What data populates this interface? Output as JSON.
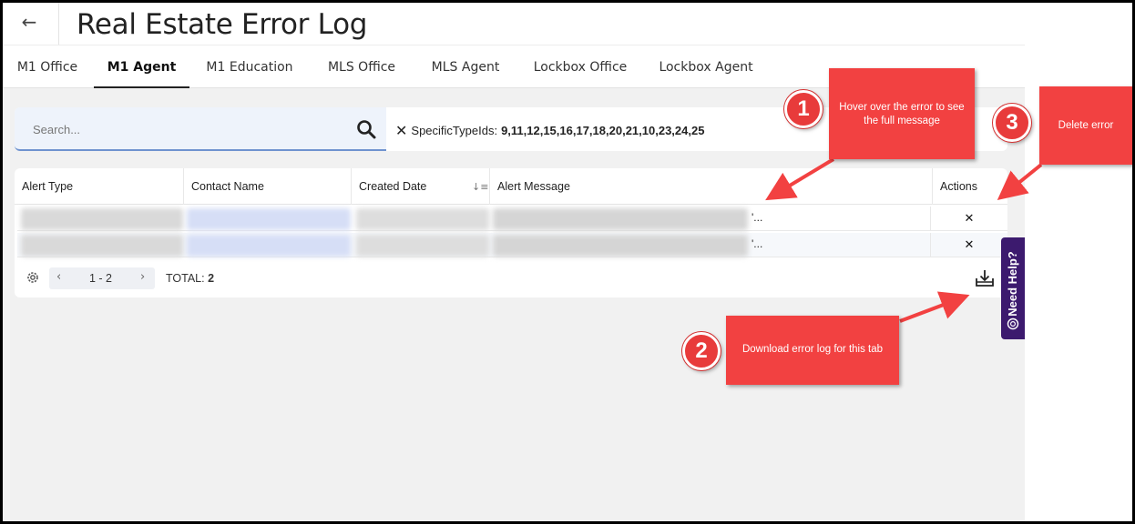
{
  "header": {
    "back_icon": "back-arrow-icon",
    "title": "Real Estate Error Log"
  },
  "tabs": [
    {
      "label": "M1 Office",
      "active": false
    },
    {
      "label": "M1 Agent",
      "active": true
    },
    {
      "label": "M1 Education",
      "active": false
    },
    {
      "label": "MLS Office",
      "active": false
    },
    {
      "label": "MLS Agent",
      "active": false
    },
    {
      "label": "Lockbox Office",
      "active": false
    },
    {
      "label": "Lockbox Agent",
      "active": false
    }
  ],
  "search": {
    "placeholder": "Search...",
    "filter_label": "SpecificTypeIds:",
    "filter_values": "9,11,12,15,16,17,18,20,21,10,23,24,25"
  },
  "table": {
    "columns": [
      "Alert Type",
      "Contact Name",
      "Created Date",
      "Alert Message",
      "Actions"
    ],
    "rows": [
      {
        "message_tail": "'...",
        "action": "✕"
      },
      {
        "message_tail": "'...",
        "action": "✕"
      }
    ]
  },
  "footer": {
    "range": "1 - 2",
    "total_label": "TOTAL:",
    "total_value": "2"
  },
  "help": {
    "label": "Need Help?"
  },
  "callouts": [
    {
      "number": "1",
      "text": "Hover over the error to see the full message"
    },
    {
      "number": "2",
      "text": "Download error log for this tab"
    },
    {
      "number": "3",
      "text": "Delete error"
    }
  ],
  "colors": {
    "callout_red": "#f24141",
    "help_purple": "#3c1a6e",
    "search_underline": "#6f93cf"
  }
}
